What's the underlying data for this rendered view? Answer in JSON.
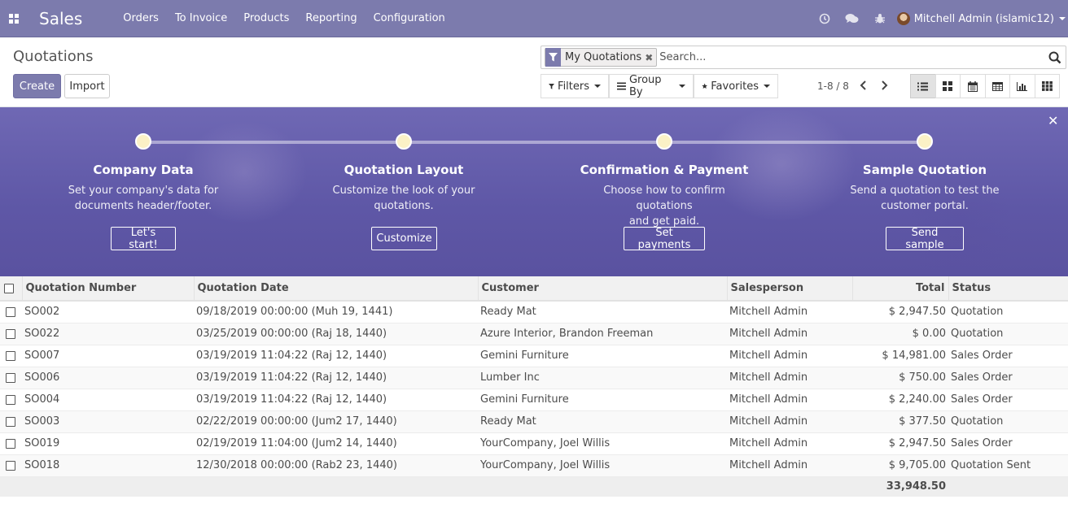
{
  "navbar": {
    "brand": "Sales",
    "menu": [
      "Orders",
      "To Invoice",
      "Products",
      "Reporting",
      "Configuration"
    ],
    "user": "Mitchell Admin (islamic12)",
    "icons": [
      "clock-icon",
      "chat-icon",
      "bug-icon"
    ]
  },
  "control_panel": {
    "breadcrumb": "Quotations",
    "create_label": "Create",
    "import_label": "Import",
    "search": {
      "facet": "My Quotations",
      "placeholder": "Search..."
    },
    "filters_label": "Filters",
    "groupby_label": "Group By",
    "favorites_label": "Favorites",
    "pager": "1-8 / 8",
    "views": [
      "list",
      "kanban",
      "calendar",
      "pivot",
      "graph",
      "activity"
    ],
    "active_view": "list"
  },
  "banner": {
    "steps": [
      {
        "title": "Company Data",
        "desc1": "Set your company's data for",
        "desc2": "documents header/footer.",
        "button": "Let's start!"
      },
      {
        "title": "Quotation Layout",
        "desc1": "Customize the look of your",
        "desc2": "quotations.",
        "button": "Customize"
      },
      {
        "title": "Confirmation & Payment",
        "desc1": "Choose how to confirm quotations",
        "desc2": "and get paid.",
        "button": "Set payments"
      },
      {
        "title": "Sample Quotation",
        "desc1": "Send a quotation to test the",
        "desc2": "customer portal.",
        "button": "Send sample"
      }
    ],
    "accent_color": "#fbf1c6"
  },
  "table": {
    "columns": [
      "Quotation Number",
      "Quotation Date",
      "Customer",
      "Salesperson",
      "Total",
      "Status"
    ],
    "rows": [
      {
        "number": "SO002",
        "date": "09/18/2019 00:00:00 (Muh 19, 1441)",
        "customer": "Ready Mat",
        "salesperson": "Mitchell Admin",
        "total": "$ 2,947.50",
        "status": "Quotation"
      },
      {
        "number": "SO022",
        "date": "03/25/2019 00:00:00 (Raj 18, 1440)",
        "customer": "Azure Interior, Brandon Freeman",
        "salesperson": "Mitchell Admin",
        "total": "$ 0.00",
        "status": "Quotation"
      },
      {
        "number": "SO007",
        "date": "03/19/2019 11:04:22 (Raj 12, 1440)",
        "customer": "Gemini Furniture",
        "salesperson": "Mitchell Admin",
        "total": "$ 14,981.00",
        "status": "Sales Order"
      },
      {
        "number": "SO006",
        "date": "03/19/2019 11:04:22 (Raj 12, 1440)",
        "customer": "Lumber Inc",
        "salesperson": "Mitchell Admin",
        "total": "$ 750.00",
        "status": "Sales Order"
      },
      {
        "number": "SO004",
        "date": "03/19/2019 11:04:22 (Raj 12, 1440)",
        "customer": "Gemini Furniture",
        "salesperson": "Mitchell Admin",
        "total": "$ 2,240.00",
        "status": "Sales Order"
      },
      {
        "number": "SO003",
        "date": "02/22/2019 00:00:00 (Jum2 17, 1440)",
        "customer": "Ready Mat",
        "salesperson": "Mitchell Admin",
        "total": "$ 377.50",
        "status": "Quotation"
      },
      {
        "number": "SO019",
        "date": "02/19/2019 11:04:00 (Jum2 14, 1440)",
        "customer": "YourCompany, Joel Willis",
        "salesperson": "Mitchell Admin",
        "total": "$ 2,947.50",
        "status": "Sales Order"
      },
      {
        "number": "SO018",
        "date": "12/30/2018 00:00:00 (Rab2 23, 1440)",
        "customer": "YourCompany, Joel Willis",
        "salesperson": "Mitchell Admin",
        "total": "$ 9,705.00",
        "status": "Quotation Sent"
      }
    ],
    "footer_total": "33,948.50"
  },
  "colors": {
    "brand": "#7c7bad"
  }
}
